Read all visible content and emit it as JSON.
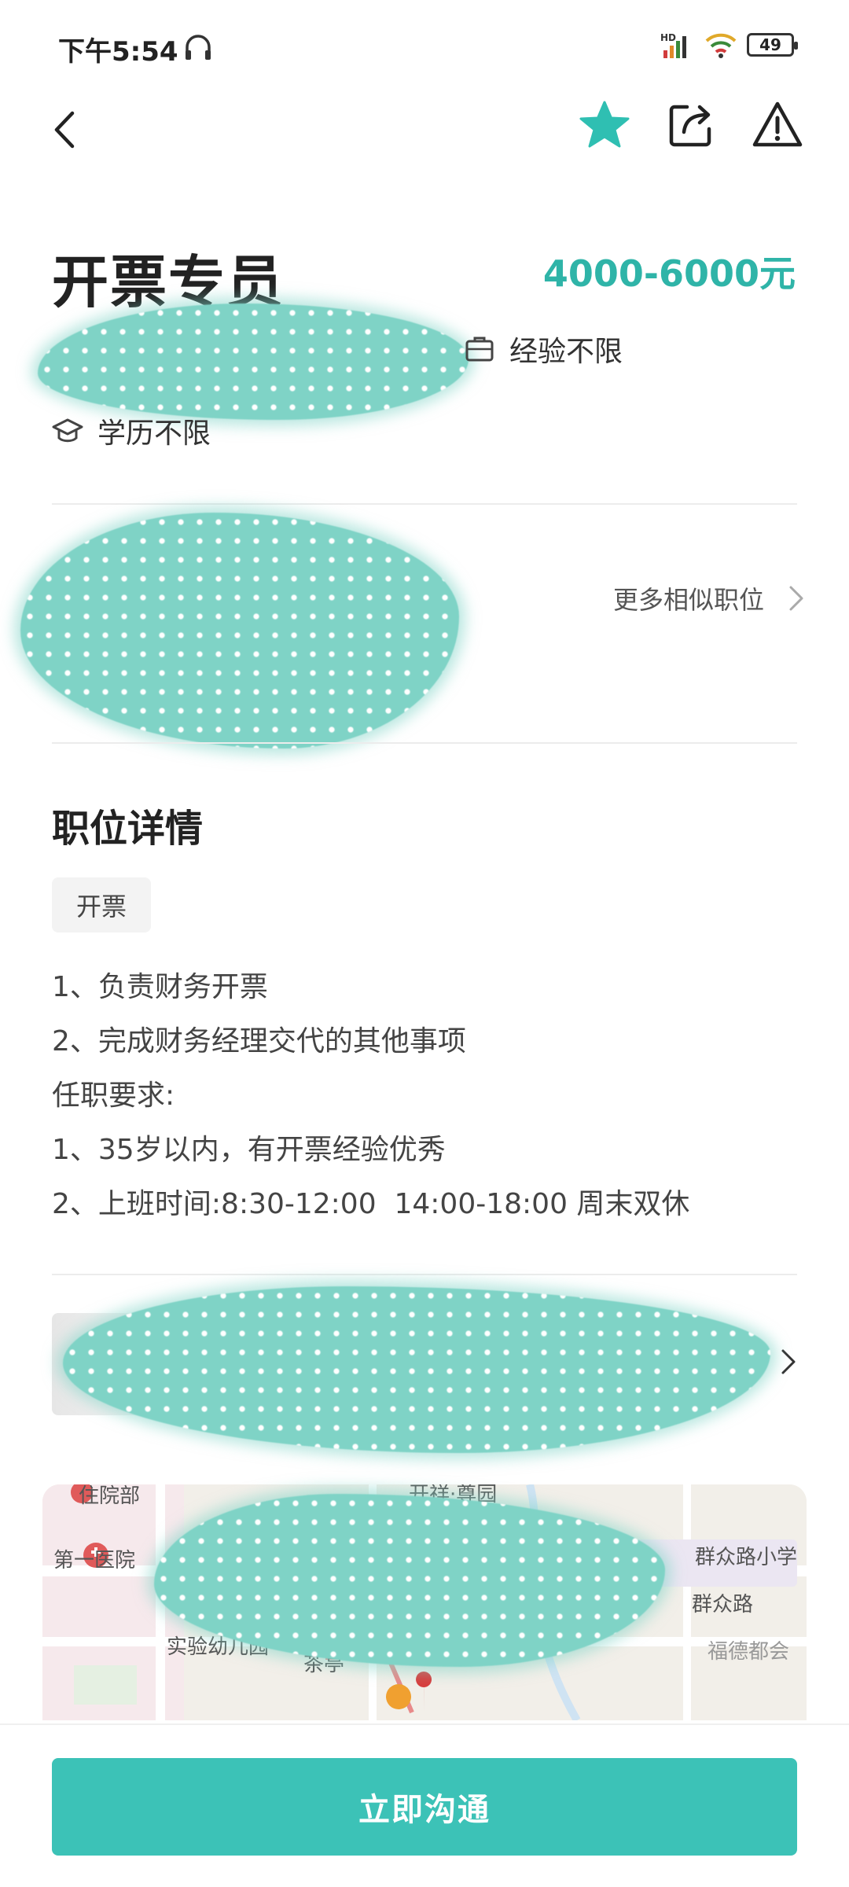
{
  "status_bar": {
    "time": "下午5:54",
    "battery": "49",
    "network": "HD"
  },
  "nav": {
    "icons": [
      "back-icon",
      "star-icon",
      "share-icon",
      "report-icon"
    ]
  },
  "job": {
    "title": "开票专员",
    "salary": "4000-6000元",
    "experience": "经验不限",
    "education": "学历不限"
  },
  "similar": {
    "label": "更多相似职位"
  },
  "details": {
    "section_title": "职位详情",
    "tag": "开票",
    "lines": [
      "1、负责财务开票",
      "2、完成财务经理交代的其他事项",
      "任职要求:",
      "1、35岁以内，有开票经验优秀",
      "2、上班时间:8:30-12:00  14:00-18:00 周末双休"
    ]
  },
  "map": {
    "labels": [
      "住院部",
      "第一医院",
      "实验幼儿园",
      "茶亭",
      "群众路小学",
      "群众路",
      "福德都会",
      "开祥·尊园"
    ]
  },
  "bottom": {
    "chat_label": "立即沟通"
  },
  "colors": {
    "accent": "#3cc2b7",
    "salary": "#2fb4a8",
    "blur": "#7fd3c6"
  }
}
